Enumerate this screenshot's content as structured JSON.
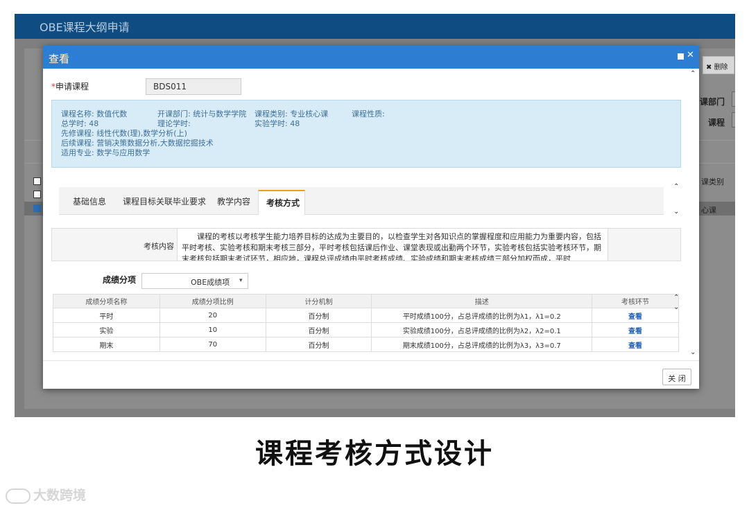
{
  "app": {
    "title": "OBE课程大纲申请",
    "delete_button": "✖ 删除",
    "right_labels": [
      "课部门",
      "课程",
      "课类别",
      "心课"
    ]
  },
  "modal": {
    "title": "查看",
    "course_label": "申请课程",
    "course_required_mark": "*",
    "course_value": "BDS011",
    "info": {
      "course_name": "课程名称: 数值代数",
      "department": "开课部门: 统计与数学学院",
      "category": "课程类别: 专业核心课",
      "nature": "课程性质:",
      "total_hours": "总学时: 48",
      "theory_hours": "理论学时:",
      "lab_hours": "实验学时: 48",
      "prerequisite": "先修课程: 线性代数(理),数学分析(上)",
      "follow_up": "后续课程: 营销决策数据分析,大数据挖掘技术",
      "majors": "适用专业: 数学与应用数学"
    },
    "tabs": [
      "基础信息",
      "课程目标关联毕业要求",
      "教学内容",
      "考核方式"
    ],
    "active_tab": "考核方式",
    "assessment": {
      "label": "考核内容",
      "text": "课程的考核以考核学生能力培养目标的达成为主要目的，以检查学生对各知识点的掌握程度和应用能力为重要内容，包括平时考核、实验考核和期末考核三部分，平时考核包括课后作业、课堂表现或出勤两个环节，实验考核包括实验考核环节，期末考核包括期末考试环节，相应地，课程总评成绩由平时考核成绩、实验成绩和期末考核成绩三部分加权而成，平时"
    },
    "score_split": {
      "label": "成绩分项",
      "selected": "OBE成绩项"
    },
    "table": {
      "headers": [
        "成绩分项名称",
        "成绩分项比例",
        "计分机制",
        "描述",
        "考核环节"
      ],
      "rows": [
        [
          "平时",
          "20",
          "百分制",
          "平时成绩100分，占总评成绩的比例为λ1，λ1=0.2",
          "查看"
        ],
        [
          "实验",
          "10",
          "百分制",
          "实验成绩100分，占总评成绩的比例为λ2，λ2=0.1",
          "查看"
        ],
        [
          "期末",
          "70",
          "百分制",
          "期末成绩100分，占总评成绩的比例为λ3，λ3=0.7",
          "查看"
        ]
      ]
    },
    "close_button": "关 闭"
  },
  "caption": "课程考核方式设计",
  "watermark": "大数跨境",
  "icons": [
    "maximize-icon",
    "close-icon",
    "chevron-up-icon",
    "chevron-down-icon",
    "dropdown-arrow-icon",
    "brand-logo-icon"
  ],
  "colors": {
    "header": "#0f4c81",
    "modal_header": "#2d7dd2",
    "info_bg": "#d8ecf7",
    "tab_accent": "#e8a020",
    "link": "#2160b8"
  }
}
